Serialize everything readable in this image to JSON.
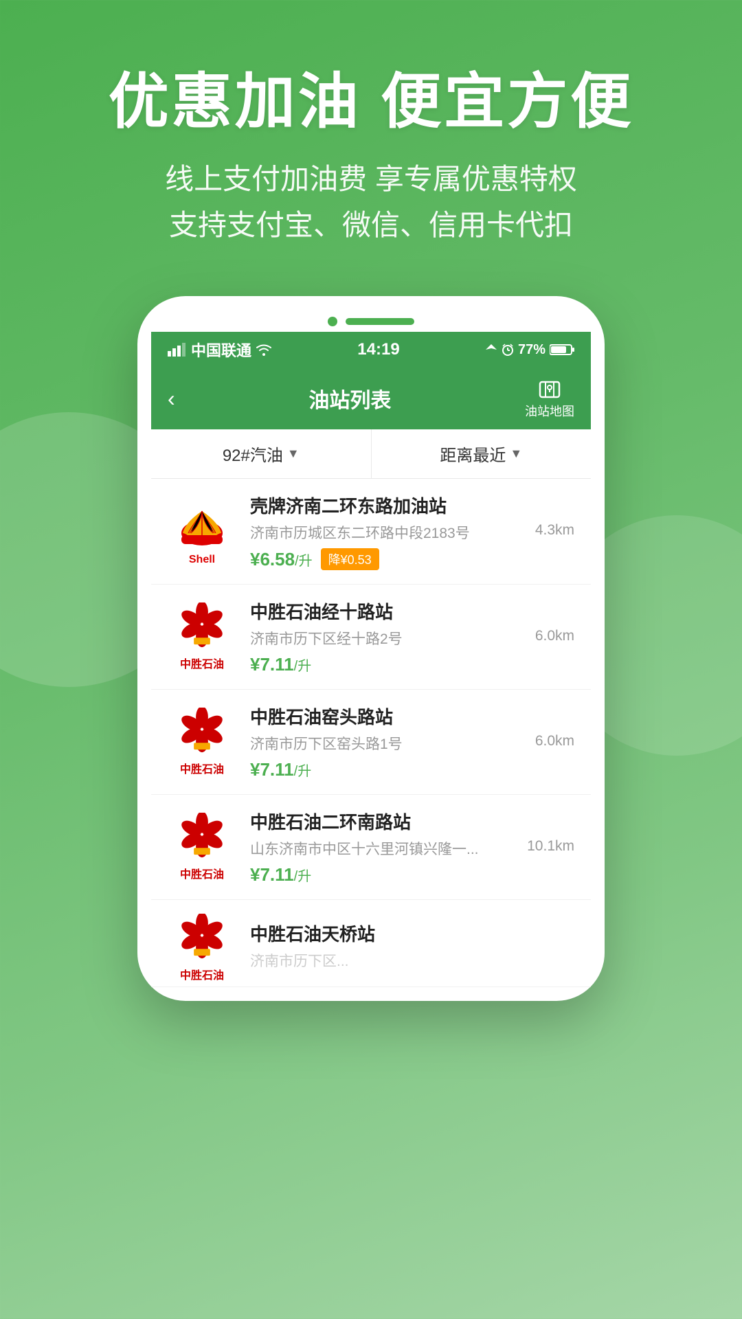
{
  "hero": {
    "title": "优惠加油 便宜方便",
    "subtitle_line1": "线上支付加油费 享专属优惠特权",
    "subtitle_line2": "支持支付宝、微信、信用卡代扣"
  },
  "phone": {
    "status": {
      "carrier": "中国联通",
      "wifi_icon": "wifi",
      "time": "14:19",
      "battery": "77%"
    },
    "nav": {
      "back_icon": "‹",
      "title": "油站列表",
      "map_label": "油站地图"
    },
    "filter": {
      "fuel_type": "92#汽油",
      "sort_type": "距离最近"
    },
    "stations": [
      {
        "id": 1,
        "brand": "Shell",
        "name": "壳牌济南二环东路加油站",
        "address": "济南市历城区东二环路中段2183号",
        "distance": "4.3km",
        "price": "¥6.58",
        "price_unit": "/升",
        "discount": "降¥0.53",
        "has_discount": true
      },
      {
        "id": 2,
        "brand": "中胜石油",
        "name": "中胜石油经十路站",
        "address": "济南市历下区经十路2号",
        "distance": "6.0km",
        "price": "¥7.11",
        "price_unit": "/升",
        "has_discount": false
      },
      {
        "id": 3,
        "brand": "中胜石油",
        "name": "中胜石油窑头路站",
        "address": "济南市历下区窑头路1号",
        "distance": "6.0km",
        "price": "¥7.11",
        "price_unit": "/升",
        "has_discount": false
      },
      {
        "id": 4,
        "brand": "中胜石油",
        "name": "中胜石油二环南路站",
        "address": "山东济南市中区十六里河镇兴隆一...",
        "distance": "10.1km",
        "price": "¥7.11",
        "price_unit": "/升",
        "has_discount": false
      },
      {
        "id": 5,
        "brand": "中胜石油",
        "name": "中胜石油天桥站",
        "address": "",
        "distance": "",
        "price": "",
        "price_unit": "",
        "has_discount": false,
        "partial": true
      }
    ]
  }
}
